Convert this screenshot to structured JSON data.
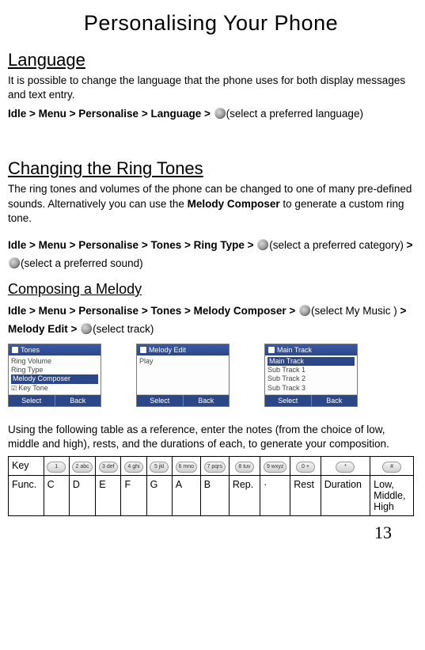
{
  "title": "Personalising Your Phone",
  "page_number": "13",
  "sections": {
    "language": {
      "heading": "Language",
      "body": "It is possible to change the language that the phone uses for both display messages and text entry.",
      "path_prefix_bold": "Idle > Menu > Personalise > Language > ",
      "path_suffix": "(select a preferred language)"
    },
    "ringtones": {
      "heading": "Changing the Ring Tones",
      "body": "The ring tones and volumes of the phone can be changed to one of many pre-defined sounds. Alternatively you can use the ",
      "body_bold": "Melody Composer",
      "body_tail": " to generate a custom ring tone.",
      "path_prefix_bold": "Idle > Menu > Personalise > Tones > Ring Type > ",
      "path_mid1": "(select a preferred category) ",
      "path_mid1_bold": "> ",
      "path_suffix": "(select a preferred sound)"
    },
    "compose": {
      "heading": "Composing a Melody",
      "path1_bold": "Idle > Menu > Personalise > Tones > Melody Composer > ",
      "path1_tail": "(select My Music ) ",
      "path2_bold": "> Melody Edit >  ",
      "path2_tail": "(select track)"
    }
  },
  "screenshots": [
    {
      "title": "Tones",
      "rows": [
        {
          "text": "Ring Volume",
          "hl": false
        },
        {
          "text": "Ring Type",
          "hl": false
        },
        {
          "text": "Melody Composer",
          "hl": true
        },
        {
          "text": "Key Tone",
          "chk": true
        }
      ],
      "left": "Select",
      "right": "Back"
    },
    {
      "title": "Melody Edit",
      "rows": [
        {
          "text": "Play",
          "hl": false
        }
      ],
      "left": "Select",
      "right": "Back"
    },
    {
      "title": "Main Track",
      "rows": [
        {
          "text": "Main Track",
          "hl": true
        },
        {
          "text": "Sub Track 1"
        },
        {
          "text": "Sub Track 2"
        },
        {
          "text": "Sub Track 3"
        }
      ],
      "left": "Select",
      "right": "Back"
    }
  ],
  "table_intro": "Using the following table as a reference, enter the notes (from the choice of low, middle and high), rests, and the durations of each, to generate your composition.",
  "key_table": {
    "row_labels": [
      "Key",
      "Func."
    ],
    "keys_glyphs": [
      "1",
      "2 abc",
      "3 def",
      "4 ghi",
      "5 jkl",
      "6 mno",
      "7 pqrs",
      "8 tuv",
      "9 wxyz",
      "0 +",
      "*",
      "#"
    ],
    "funcs": [
      "C",
      "D",
      "E",
      "F",
      "G",
      "A",
      "B",
      "Rep.",
      "·",
      "Rest",
      "Duration",
      "Low, Middle, High"
    ]
  }
}
